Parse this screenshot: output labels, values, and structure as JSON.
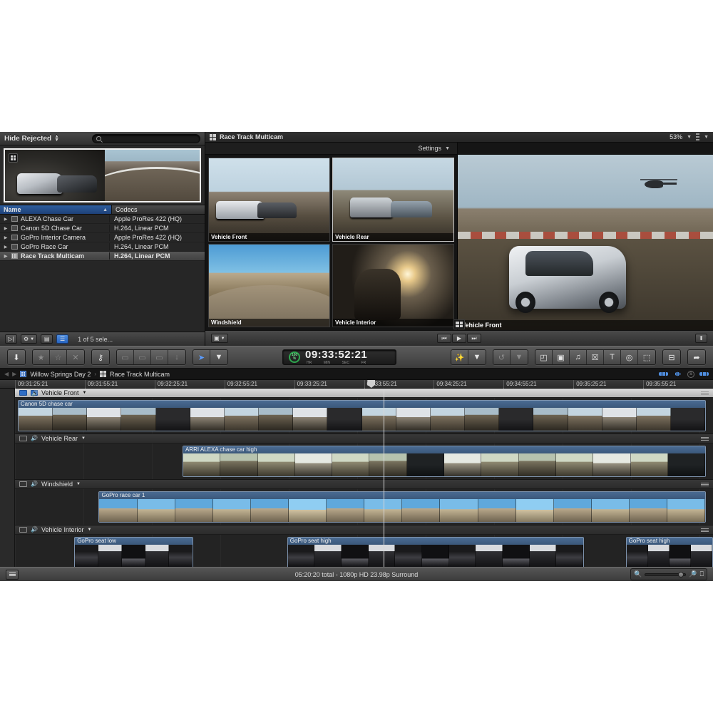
{
  "app": {
    "name": "Final Cut Pro X"
  },
  "browser": {
    "filter_label": "Hide Rejected",
    "search_placeholder": "",
    "search_value": "",
    "grid_icon": "grid-icon",
    "columns": {
      "name": "Name",
      "codecs": "Codecs",
      "sort_glyph": "▲"
    },
    "clips": [
      {
        "name": "ALEXA Chase Car",
        "codec": "Apple ProRes 422 (HQ)",
        "selected": false,
        "multicam": false
      },
      {
        "name": "Canon 5D Chase Car",
        "codec": "H.264, Linear PCM",
        "selected": false,
        "multicam": false
      },
      {
        "name": "GoPro Interior Camera",
        "codec": "Apple ProRes 422 (HQ)",
        "selected": false,
        "multicam": false
      },
      {
        "name": "GoPro Race Car",
        "codec": "H.264, Linear PCM",
        "selected": false,
        "multicam": false
      },
      {
        "name": "Race Track Multicam",
        "codec": "H.264, Linear PCM",
        "selected": true,
        "multicam": true
      }
    ],
    "footer": {
      "import_icon": "import-icon",
      "action_icon": "gear-icon",
      "filmstrip_icon": "filmstrip-view-icon",
      "list_icon": "list-view-icon",
      "selection_status": "1 of 5 sele..."
    }
  },
  "viewer": {
    "title": "Race Track Multicam",
    "title_icon": "multicam-icon",
    "zoom_level": "53%",
    "settings_label": "Settings",
    "angles": [
      {
        "label": "Vehicle Front",
        "selected": false
      },
      {
        "label": "Vehicle Rear",
        "selected": true
      },
      {
        "label": "Windshield",
        "selected": false
      },
      {
        "label": "Vehicle Interior",
        "selected": false
      }
    ],
    "main_angle_label": "Vehicle Front",
    "controls": {
      "view_options_icon": "view-options-icon",
      "prev_icon": "go-to-start-icon",
      "play_icon": "play-icon",
      "next_icon": "go-to-end-icon",
      "fullscreen_icon": "fullscreen-icon"
    },
    "angle_grid_icon": "angle-grid-icon"
  },
  "toolbar": {
    "left_groups": [
      [
        {
          "icon": "import-media-icon",
          "label": "⬇",
          "dim": false
        }
      ],
      [
        {
          "icon": "favorite-icon",
          "label": "★",
          "dim": true
        },
        {
          "icon": "unrate-icon",
          "label": "☆",
          "dim": true
        },
        {
          "icon": "reject-icon",
          "label": "✕",
          "dim": true
        }
      ],
      [
        {
          "icon": "keyword-icon",
          "label": "⚷",
          "dim": false
        }
      ],
      [
        {
          "icon": "connect-clip-icon",
          "label": "▭",
          "dim": true
        },
        {
          "icon": "insert-clip-icon",
          "label": "▭",
          "dim": true
        },
        {
          "icon": "append-clip-icon",
          "label": "▭",
          "dim": true
        },
        {
          "icon": "overwrite-clip-icon",
          "label": "↓",
          "dim": true
        }
      ],
      [
        {
          "icon": "select-tool-icon",
          "label": "➤",
          "dim": false
        },
        {
          "icon": "tool-chevron-icon",
          "label": "▼",
          "dim": false
        }
      ]
    ],
    "timecode": {
      "value": "09:33:52:21",
      "percent": "100",
      "percent_unit": "%",
      "units": [
        "HR",
        "MIN",
        "SEC",
        "FR"
      ]
    },
    "right_groups": [
      [
        {
          "icon": "enhancements-icon",
          "label": "✨",
          "dim": false
        },
        {
          "icon": "enhancements-chevron-icon",
          "label": "▼",
          "dim": false
        }
      ],
      [
        {
          "icon": "retime-icon",
          "label": "↺",
          "dim": true
        },
        {
          "icon": "retime-chevron-icon",
          "label": "▼",
          "dim": true
        }
      ],
      [
        {
          "icon": "video-effects-icon",
          "label": "◰",
          "dim": false
        },
        {
          "icon": "photos-audio-icon",
          "label": "▣",
          "dim": false
        },
        {
          "icon": "music-icon",
          "label": "♫",
          "dim": false
        },
        {
          "icon": "transitions-icon",
          "label": "☒",
          "dim": false
        },
        {
          "icon": "titles-icon",
          "label": "T",
          "dim": false
        },
        {
          "icon": "generators-icon",
          "label": "◎",
          "dim": false
        },
        {
          "icon": "themes-icon",
          "label": "⬚",
          "dim": false
        }
      ],
      [
        {
          "icon": "inspector-icon",
          "label": "⊟",
          "dim": false
        }
      ],
      [
        {
          "icon": "share-icon",
          "label": "➦",
          "dim": false
        }
      ]
    ]
  },
  "timeline": {
    "breadcrumb": {
      "back_icon": "back-arrow-icon",
      "forward_icon": "forward-arrow-icon",
      "event_icon": "project-icon",
      "event": "Willow Springs Day 2",
      "separator": "›",
      "project_icon": "multicam-icon",
      "project": "Race Track Multicam"
    },
    "right_icons": [
      {
        "icon": "video-role-icon"
      },
      {
        "icon": "audio-waveform-icon"
      },
      {
        "icon": "solo-icon",
        "label": "S"
      },
      {
        "icon": "clip-appearance-icon"
      }
    ],
    "ruler_ticks": [
      "09:31:25:21",
      "09:31:55:21",
      "09:32:25:21",
      "09:32:55:21",
      "09:33:25:21",
      "09:33:55:21",
      "09:34:25:21",
      "09:34:55:21",
      "09:35:25:21",
      "09:35:55:21"
    ],
    "playhead_percent": 52.8,
    "skimmer_percent": 51.0,
    "tracks": [
      {
        "name": "Vehicle Front",
        "active": true,
        "clips": [
          {
            "name": "Canon 5D chase car",
            "left_pct": 0.4,
            "width_pct": 98.6,
            "thumbs": 20
          }
        ]
      },
      {
        "name": "Vehicle Rear",
        "active": false,
        "clips": [
          {
            "name": "ARRI ALEXA chase car high",
            "left_pct": 24.0,
            "width_pct": 75.0,
            "thumbs": 14
          }
        ]
      },
      {
        "name": "Windshield",
        "active": false,
        "clips": [
          {
            "name": "GoPro race car 1",
            "left_pct": 12.0,
            "width_pct": 87.0,
            "thumbs": 16
          }
        ]
      },
      {
        "name": "Vehicle Interior",
        "active": false,
        "clips": [
          {
            "name": "GoPro seat low",
            "left_pct": 8.5,
            "width_pct": 17.0,
            "thumbs": 5
          },
          {
            "name": "GoPro seat high",
            "left_pct": 39.0,
            "width_pct": 42.5,
            "thumbs": 11
          },
          {
            "name": "GoPro seat high",
            "left_pct": 87.5,
            "width_pct": 12.5,
            "thumbs": 4
          }
        ]
      }
    ]
  },
  "statusbar": {
    "index_icon": "timeline-index-icon",
    "info": "05:20:20 total - 1080p HD 23.98p Surround",
    "zoom_out_icon": "zoom-out-icon",
    "zoom_in_icon": "zoom-in-icon",
    "fit_icon": "fit-to-window-icon"
  }
}
